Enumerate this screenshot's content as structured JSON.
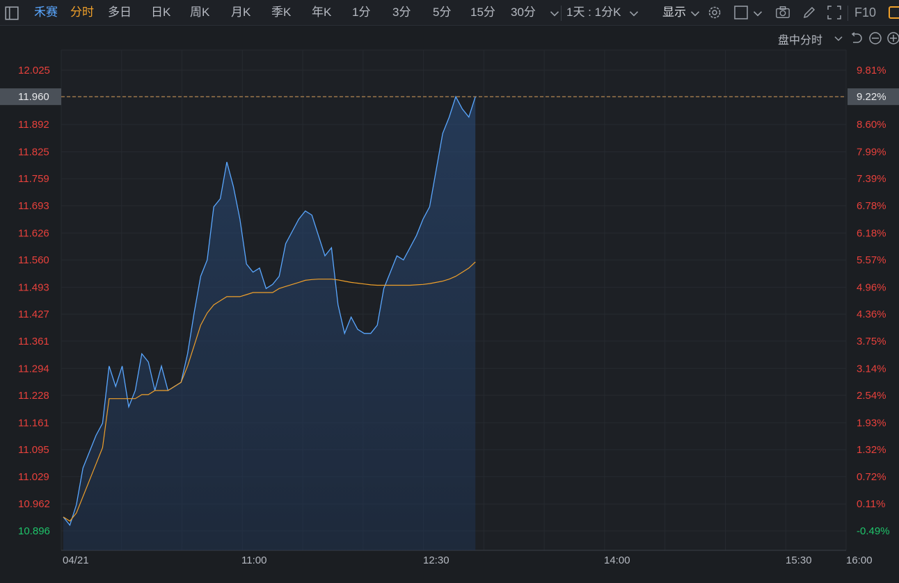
{
  "toolbar": {
    "stock_name": "禾赛",
    "items": [
      "分时",
      "多日",
      "日K",
      "周K",
      "月K",
      "季K",
      "年K",
      "1分",
      "3分",
      "5分",
      "15分",
      "30分"
    ],
    "period_select": "1天 : 1分K",
    "display_label": "显示",
    "f10_label": "F10"
  },
  "sub_toolbar": {
    "mode_label": "盘中分时"
  },
  "colors": {
    "price_line": "#5aa7ff",
    "avg_line": "#f0a02a",
    "up": "#e8413c",
    "down": "#1fc36a",
    "grid": "#262a30",
    "dashed": "#d9a05a"
  },
  "chart_data": {
    "type": "line",
    "ylim": [
      10.896,
      12.025
    ],
    "y_ticks_price": [
      "12.025",
      "11.960",
      "11.892",
      "11.825",
      "11.759",
      "11.693",
      "11.626",
      "11.560",
      "11.493",
      "11.427",
      "11.361",
      "11.294",
      "11.228",
      "11.161",
      "11.095",
      "11.029",
      "10.962",
      "10.896"
    ],
    "y_ticks_pct": [
      "9.81%",
      "9.22%",
      "8.60%",
      "7.99%",
      "7.39%",
      "6.78%",
      "6.18%",
      "5.57%",
      "4.96%",
      "4.36%",
      "3.75%",
      "3.14%",
      "2.54%",
      "1.93%",
      "1.32%",
      "0.72%",
      "0.11%",
      "-0.49%"
    ],
    "x_ticks": [
      "04/21",
      "11:00",
      "12:30",
      "14:00",
      "15:30",
      "16:00"
    ],
    "current_price": "11.960",
    "current_pct": "9.22%",
    "series": [
      {
        "values": [
          10.93,
          10.91,
          10.96,
          11.05,
          11.09,
          11.13,
          11.16,
          11.3,
          11.25,
          11.3,
          11.2,
          11.24,
          11.33,
          11.31,
          11.24,
          11.3,
          11.24,
          11.25,
          11.26,
          11.33,
          11.43,
          11.52,
          11.56,
          11.69,
          11.71,
          11.8,
          11.74,
          11.66,
          11.55,
          11.53,
          11.54,
          11.49,
          11.5,
          11.52,
          11.6,
          11.63,
          11.66,
          11.68,
          11.67,
          11.62,
          11.57,
          11.59,
          11.45,
          11.38,
          11.42,
          11.39,
          11.38,
          11.38,
          11.4,
          11.49,
          11.53,
          11.57,
          11.56,
          11.59,
          11.62,
          11.66,
          11.69,
          11.78,
          11.87,
          11.91,
          11.96,
          11.93,
          11.91,
          11.96
        ]
      },
      {
        "values": [
          10.93,
          10.92,
          10.94,
          10.98,
          11.02,
          11.06,
          11.1,
          11.22,
          11.22,
          11.22,
          11.22,
          11.22,
          11.23,
          11.23,
          11.24,
          11.24,
          11.24,
          11.25,
          11.26,
          11.3,
          11.35,
          11.4,
          11.43,
          11.45,
          11.46,
          11.47,
          11.47,
          11.47,
          11.475,
          11.48,
          11.48,
          11.48,
          11.48,
          11.49,
          11.495,
          11.5,
          11.505,
          11.51,
          11.512,
          11.513,
          11.513,
          11.513,
          11.511,
          11.508,
          11.505,
          11.503,
          11.501,
          11.499,
          11.498,
          11.498,
          11.498,
          11.498,
          11.498,
          11.498,
          11.499,
          11.5,
          11.502,
          11.505,
          11.508,
          11.513,
          11.52,
          11.53,
          11.54,
          11.555
        ]
      }
    ]
  }
}
